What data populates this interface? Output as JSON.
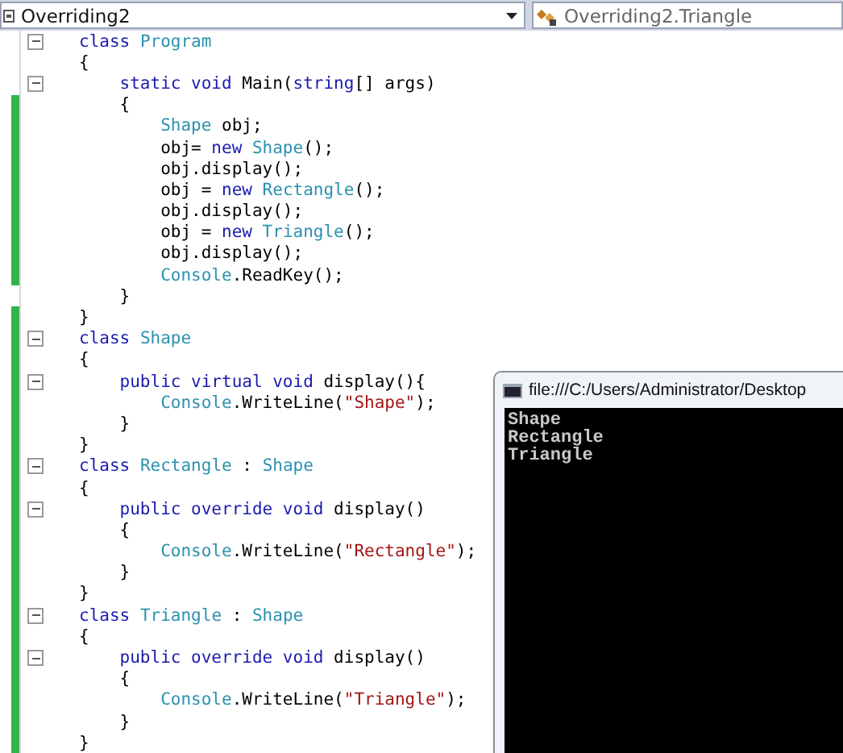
{
  "toolbar": {
    "class_combo": "Overriding2",
    "member_combo": "Overriding2.Triangle"
  },
  "lines": [
    {
      "changed": false,
      "fold": true,
      "tokens": [
        {
          "kind": "keyword",
          "text": "class "
        },
        {
          "kind": "type",
          "text": "Program"
        }
      ]
    },
    {
      "changed": false,
      "fold": false,
      "tokens": [
        {
          "kind": "plain",
          "text": "{"
        }
      ],
      "children": [
        {
          "changed": false,
          "fold": true,
          "tokens": [
            {
              "kind": "keyword",
              "text": "static void "
            },
            {
              "kind": "plain",
              "text": "Main("
            },
            {
              "kind": "keyword",
              "text": "string"
            },
            {
              "kind": "plain",
              "text": "[] args)"
            }
          ]
        },
        {
          "changed": true,
          "fold": false,
          "tokens": [
            {
              "kind": "plain",
              "text": "{"
            }
          ],
          "children": [
            {
              "changed": true,
              "fold": false,
              "tokens": [
                {
                  "kind": "type",
                  "text": "Shape"
                },
                {
                  "kind": "plain",
                  "text": " obj;"
                }
              ]
            },
            {
              "changed": true,
              "fold": false,
              "tokens": [
                {
                  "kind": "plain",
                  "text": "obj= "
                },
                {
                  "kind": "keyword",
                  "text": "new "
                },
                {
                  "kind": "type",
                  "text": "Shape"
                },
                {
                  "kind": "plain",
                  "text": "();"
                }
              ]
            },
            {
              "changed": true,
              "fold": false,
              "tokens": [
                {
                  "kind": "plain",
                  "text": "obj.display();"
                }
              ]
            },
            {
              "changed": true,
              "fold": false,
              "tokens": [
                {
                  "kind": "plain",
                  "text": "obj = "
                },
                {
                  "kind": "keyword",
                  "text": "new "
                },
                {
                  "kind": "type",
                  "text": "Rectangle"
                },
                {
                  "kind": "plain",
                  "text": "();"
                }
              ]
            },
            {
              "changed": true,
              "fold": false,
              "tokens": [
                {
                  "kind": "plain",
                  "text": "obj.display();"
                }
              ]
            },
            {
              "changed": true,
              "fold": false,
              "tokens": [
                {
                  "kind": "plain",
                  "text": "obj = "
                },
                {
                  "kind": "keyword",
                  "text": "new "
                },
                {
                  "kind": "type",
                  "text": "Triangle"
                },
                {
                  "kind": "plain",
                  "text": "();"
                }
              ]
            },
            {
              "changed": true,
              "fold": false,
              "tokens": [
                {
                  "kind": "plain",
                  "text": "obj.display();"
                }
              ]
            },
            {
              "changed": true,
              "fold": false,
              "tokens": [
                {
                  "kind": "type",
                  "text": "Console"
                },
                {
                  "kind": "plain",
                  "text": ".ReadKey();"
                }
              ]
            }
          ]
        },
        {
          "changed": false,
          "fold": false,
          "tokens": [
            {
              "kind": "plain",
              "text": "}"
            }
          ]
        }
      ]
    },
    {
      "changed": true,
      "fold": false,
      "tokens": [
        {
          "kind": "plain",
          "text": "}"
        }
      ]
    },
    {
      "changed": true,
      "fold": true,
      "tokens": [
        {
          "kind": "keyword",
          "text": "class "
        },
        {
          "kind": "type",
          "text": "Shape"
        }
      ]
    },
    {
      "changed": true,
      "fold": false,
      "tokens": [
        {
          "kind": "plain",
          "text": "{"
        }
      ],
      "children": [
        {
          "changed": true,
          "fold": true,
          "tokens": [
            {
              "kind": "keyword",
              "text": "public virtual void "
            },
            {
              "kind": "plain",
              "text": "display(){"
            }
          ],
          "children": [
            {
              "changed": true,
              "fold": false,
              "tokens": [
                {
                  "kind": "type",
                  "text": "Console"
                },
                {
                  "kind": "plain",
                  "text": ".WriteLine("
                },
                {
                  "kind": "string",
                  "text": "\"Shape\""
                },
                {
                  "kind": "plain",
                  "text": ");"
                }
              ]
            }
          ]
        },
        {
          "changed": true,
          "fold": false,
          "tokens": [
            {
              "kind": "plain",
              "text": "}"
            }
          ]
        }
      ]
    },
    {
      "changed": true,
      "fold": false,
      "tokens": [
        {
          "kind": "plain",
          "text": "}"
        }
      ]
    },
    {
      "changed": true,
      "fold": true,
      "tokens": [
        {
          "kind": "keyword",
          "text": "class "
        },
        {
          "kind": "type",
          "text": "Rectangle"
        },
        {
          "kind": "plain",
          "text": " : "
        },
        {
          "kind": "type",
          "text": "Shape"
        }
      ]
    },
    {
      "changed": true,
      "fold": false,
      "tokens": [
        {
          "kind": "plain",
          "text": "{"
        }
      ],
      "children": [
        {
          "changed": true,
          "fold": true,
          "tokens": [
            {
              "kind": "keyword",
              "text": "public override void "
            },
            {
              "kind": "plain",
              "text": "display()"
            }
          ]
        },
        {
          "changed": true,
          "fold": false,
          "tokens": [
            {
              "kind": "plain",
              "text": "{"
            }
          ],
          "children": [
            {
              "changed": true,
              "fold": false,
              "tokens": [
                {
                  "kind": "type",
                  "text": "Console"
                },
                {
                  "kind": "plain",
                  "text": ".WriteLine("
                },
                {
                  "kind": "string",
                  "text": "\"Rectangle\""
                },
                {
                  "kind": "plain",
                  "text": ");"
                }
              ]
            }
          ]
        },
        {
          "changed": true,
          "fold": false,
          "tokens": [
            {
              "kind": "plain",
              "text": "}"
            }
          ]
        }
      ]
    },
    {
      "changed": true,
      "fold": false,
      "tokens": [
        {
          "kind": "plain",
          "text": "}"
        }
      ]
    },
    {
      "changed": true,
      "fold": true,
      "tokens": [
        {
          "kind": "keyword",
          "text": "class "
        },
        {
          "kind": "type",
          "text": "Triangle"
        },
        {
          "kind": "plain",
          "text": " : "
        },
        {
          "kind": "type",
          "text": "Shape"
        }
      ]
    },
    {
      "changed": true,
      "fold": false,
      "tokens": [
        {
          "kind": "plain",
          "text": "{"
        }
      ],
      "children": [
        {
          "changed": true,
          "fold": true,
          "tokens": [
            {
              "kind": "keyword",
              "text": "public override void "
            },
            {
              "kind": "plain",
              "text": "display()"
            }
          ]
        },
        {
          "changed": true,
          "fold": false,
          "tokens": [
            {
              "kind": "plain",
              "text": "{"
            }
          ],
          "children": [
            {
              "changed": true,
              "fold": false,
              "tokens": [
                {
                  "kind": "type",
                  "text": "Console"
                },
                {
                  "kind": "plain",
                  "text": ".WriteLine("
                },
                {
                  "kind": "string",
                  "text": "\"Triangle\""
                },
                {
                  "kind": "plain",
                  "text": ");"
                }
              ]
            }
          ]
        },
        {
          "changed": true,
          "fold": false,
          "tokens": [
            {
              "kind": "plain",
              "text": "}"
            }
          ]
        }
      ]
    },
    {
      "changed": true,
      "fold": false,
      "tokens": [
        {
          "kind": "plain",
          "text": "}"
        }
      ]
    }
  ],
  "console": {
    "title": "file:///C:/Users/Administrator/Desktop",
    "output": [
      "Shape",
      "Rectangle",
      "Triangle"
    ]
  }
}
